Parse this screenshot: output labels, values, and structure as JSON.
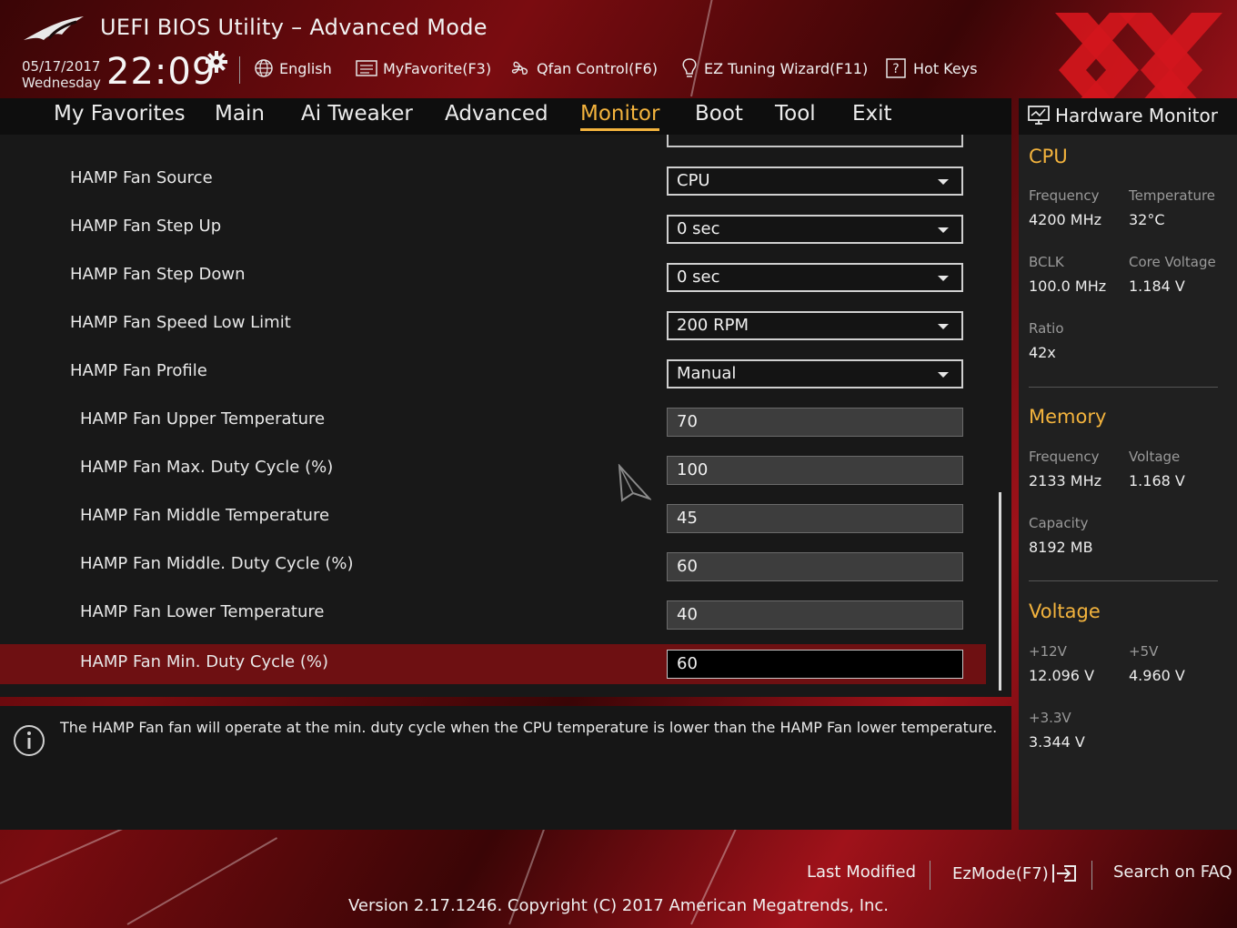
{
  "app": {
    "title": "UEFI BIOS Utility – Advanced Mode",
    "date": "05/17/2017",
    "weekday": "Wednesday",
    "time": "22:09"
  },
  "toolbar": {
    "language": "English",
    "my_favorite": "MyFavorite(F3)",
    "qfan": "Qfan Control(F6)",
    "ez_tuning": "EZ Tuning Wizard(F11)",
    "hot_keys": "Hot Keys"
  },
  "nav": {
    "tabs": [
      {
        "label": "My Favorites",
        "active": false
      },
      {
        "label": "Main",
        "active": false
      },
      {
        "label": "Ai Tweaker",
        "active": false
      },
      {
        "label": "Advanced",
        "active": false
      },
      {
        "label": "Monitor",
        "active": true
      },
      {
        "label": "Boot",
        "active": false
      },
      {
        "label": "Tool",
        "active": false
      },
      {
        "label": "Exit",
        "active": false
      }
    ]
  },
  "settings": [
    {
      "label": "HAMP Fan Source",
      "type": "select",
      "value": "CPU"
    },
    {
      "label": "HAMP Fan Step Up",
      "type": "select",
      "value": "0 sec"
    },
    {
      "label": "HAMP Fan Step Down",
      "type": "select",
      "value": "0 sec"
    },
    {
      "label": "HAMP Fan Speed Low Limit",
      "type": "select",
      "value": "200 RPM"
    },
    {
      "label": "HAMP Fan Profile",
      "type": "select",
      "value": "Manual"
    },
    {
      "label": "HAMP Fan Upper Temperature",
      "type": "input",
      "value": "70"
    },
    {
      "label": "HAMP Fan Max. Duty Cycle (%)",
      "type": "input",
      "value": "100"
    },
    {
      "label": "HAMP Fan Middle Temperature",
      "type": "input",
      "value": "45"
    },
    {
      "label": "HAMP Fan Middle. Duty Cycle (%)",
      "type": "input",
      "value": "60"
    },
    {
      "label": "HAMP Fan Lower Temperature",
      "type": "input",
      "value": "40"
    },
    {
      "label": "HAMP Fan Min. Duty Cycle (%)",
      "type": "input",
      "value": "60",
      "selected": true
    }
  ],
  "help": {
    "text": "The HAMP Fan fan will operate at the min. duty cycle when the CPU temperature is lower than the HAMP Fan lower temperature."
  },
  "hardware_monitor": {
    "title": "Hardware Monitor",
    "cpu": {
      "heading": "CPU",
      "frequency_label": "Frequency",
      "frequency": "4200 MHz",
      "temperature_label": "Temperature",
      "temperature": "32°C",
      "bclk_label": "BCLK",
      "bclk": "100.0 MHz",
      "core_voltage_label": "Core Voltage",
      "core_voltage": "1.184 V",
      "ratio_label": "Ratio",
      "ratio": "42x"
    },
    "memory": {
      "heading": "Memory",
      "frequency_label": "Frequency",
      "frequency": "2133 MHz",
      "voltage_label": "Voltage",
      "voltage": "1.168 V",
      "capacity_label": "Capacity",
      "capacity": "8192 MB"
    },
    "voltage": {
      "heading": "Voltage",
      "v12_label": "+12V",
      "v12": "12.096 V",
      "v5_label": "+5V",
      "v5": "4.960 V",
      "v33_label": "+3.3V",
      "v33": "3.344 V"
    }
  },
  "footer": {
    "last_modified": "Last Modified",
    "ez_mode": "EzMode(F7)",
    "search_faq": "Search on FAQ",
    "version": "Version 2.17.1246. Copyright (C) 2017 American Megatrends, Inc."
  },
  "colors": {
    "accent": "#f3b33d",
    "selected_row": "#6e1012",
    "panel": "#181818"
  }
}
